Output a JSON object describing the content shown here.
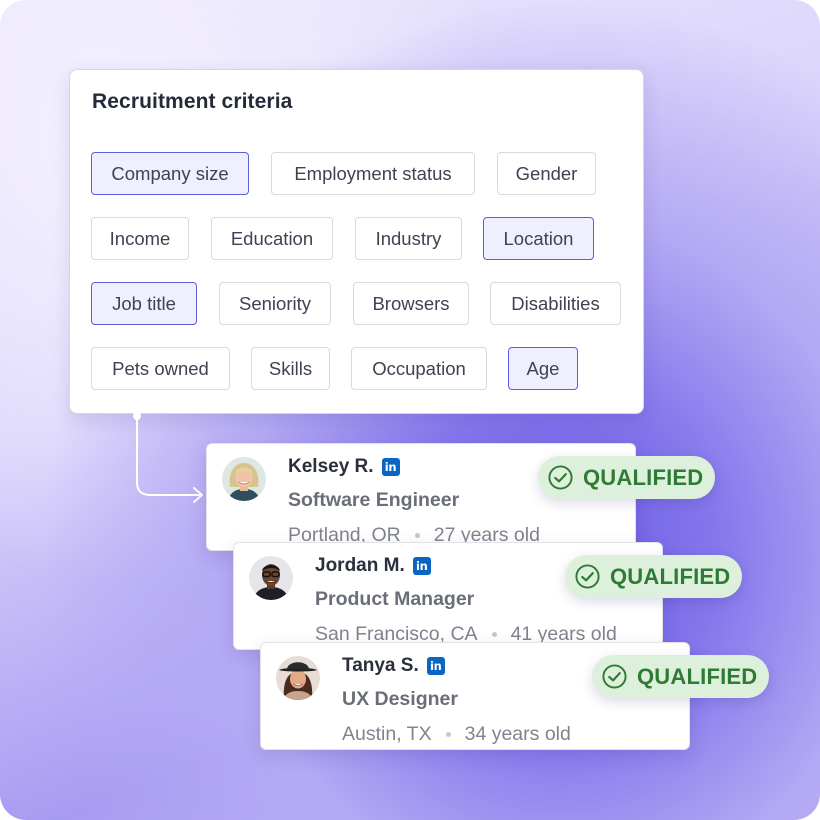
{
  "criteria": {
    "title": "Recruitment criteria",
    "chips": [
      {
        "label": "Company size",
        "selected": true
      },
      {
        "label": "Employment status",
        "selected": false
      },
      {
        "label": "Gender",
        "selected": false
      },
      {
        "label": "Income",
        "selected": false
      },
      {
        "label": "Education",
        "selected": false
      },
      {
        "label": "Industry",
        "selected": false
      },
      {
        "label": "Location",
        "selected": true
      },
      {
        "label": "Job title",
        "selected": true
      },
      {
        "label": "Seniority",
        "selected": false
      },
      {
        "label": "Browsers",
        "selected": false
      },
      {
        "label": "Disabilities",
        "selected": false
      },
      {
        "label": "Pets owned",
        "selected": false
      },
      {
        "label": "Skills",
        "selected": false
      },
      {
        "label": "Occupation",
        "selected": false
      },
      {
        "label": "Age",
        "selected": true
      }
    ]
  },
  "candidates": [
    {
      "name": "Kelsey R.",
      "role": "Software Engineer",
      "location": "Portland, OR",
      "age": "27 years old",
      "status": "QUALIFIED",
      "social_icon": "linkedin-icon"
    },
    {
      "name": "Jordan M.",
      "role": "Product Manager",
      "location": "San Francisco, CA",
      "age": "41 years old",
      "status": "QUALIFIED",
      "social_icon": "linkedin-icon"
    },
    {
      "name": "Tanya S.",
      "role": "UX Designer",
      "location": "Austin, TX",
      "age": "34 years old",
      "status": "QUALIFIED",
      "social_icon": "linkedin-icon"
    }
  ],
  "colors": {
    "accent": "#5b5fd9",
    "selected_chip_bg": "#eef0fd",
    "qualified_bg": "#ddf0db",
    "qualified_text": "#2f7a35",
    "linkedin": "#0a66c2"
  }
}
